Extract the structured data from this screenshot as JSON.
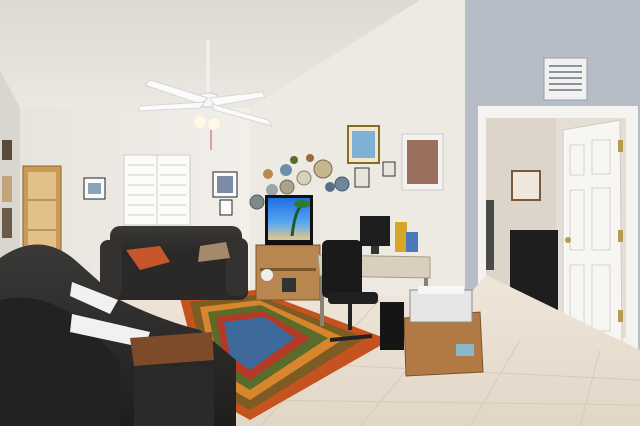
{
  "scene": {
    "kind": "interior-photograph",
    "room": "living room",
    "palette": {
      "wall_left": "#ece9e4",
      "wall_center": "#efece7",
      "wall_right_gray": "#b9bfc8",
      "ceiling": "#e6e3dd",
      "floor_tile": "#e7ddd0",
      "sofa_leather": "#2b2a29",
      "rug_orange": "#c4531f",
      "rug_green": "#5b6b2a",
      "tv_screen_sky": "#2f7fe0",
      "door_white": "#f7f6f3"
    },
    "objects": [
      {
        "name": "ceiling-fan"
      },
      {
        "name": "window-shutters"
      },
      {
        "name": "leather-loveseat"
      },
      {
        "name": "leather-recliner"
      },
      {
        "name": "striped-area-rug"
      },
      {
        "name": "tv-stand-with-tv"
      },
      {
        "name": "plate-collection-wall"
      },
      {
        "name": "computer-desk"
      },
      {
        "name": "office-chair"
      },
      {
        "name": "printer-cart"
      },
      {
        "name": "white-panel-door"
      },
      {
        "name": "hvac-vent"
      }
    ]
  }
}
